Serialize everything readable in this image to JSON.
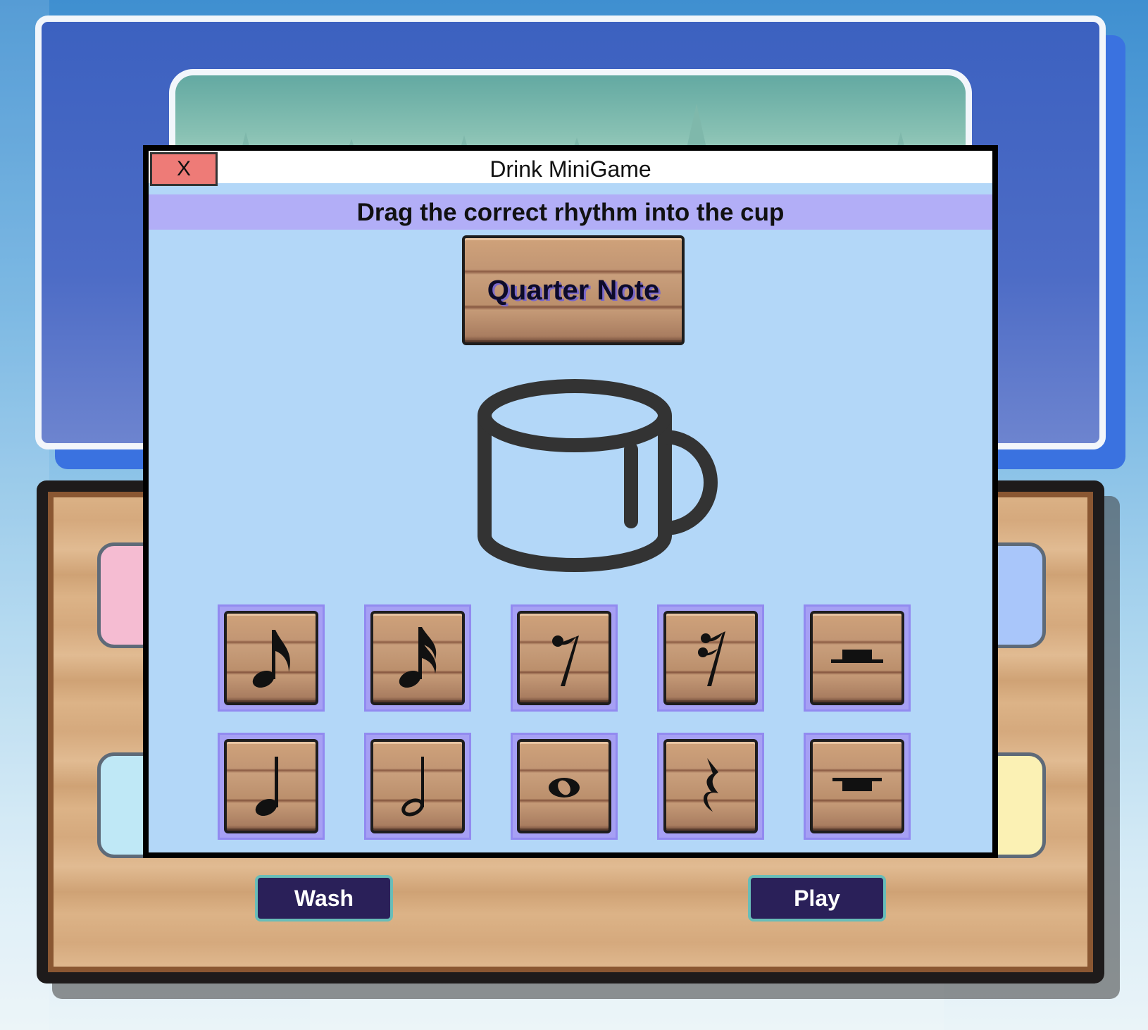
{
  "modal": {
    "close_label": "X",
    "title": "Drink MiniGame",
    "instruction": "Drag the correct rhythm into the cup",
    "target_note": "Quarter Note"
  },
  "tiles": [
    {
      "icon": "eighth-note-icon"
    },
    {
      "icon": "sixteenth-note-icon"
    },
    {
      "icon": "eighth-rest-icon"
    },
    {
      "icon": "sixteenth-rest-icon"
    },
    {
      "icon": "half-rest-icon"
    },
    {
      "icon": "quarter-note-icon"
    },
    {
      "icon": "half-note-icon"
    },
    {
      "icon": "whole-note-icon"
    },
    {
      "icon": "quarter-rest-icon"
    },
    {
      "icon": "whole-rest-icon"
    }
  ],
  "counter": {
    "wash_label": "Wash",
    "play_label": "Play"
  },
  "colors": {
    "modal_bg": "#b3d7f8",
    "instruction_bg": "#b2aef7",
    "close_bg": "#ee7b77",
    "button_bg": "#2a2059",
    "tile_frame": "#a6a0f4"
  }
}
